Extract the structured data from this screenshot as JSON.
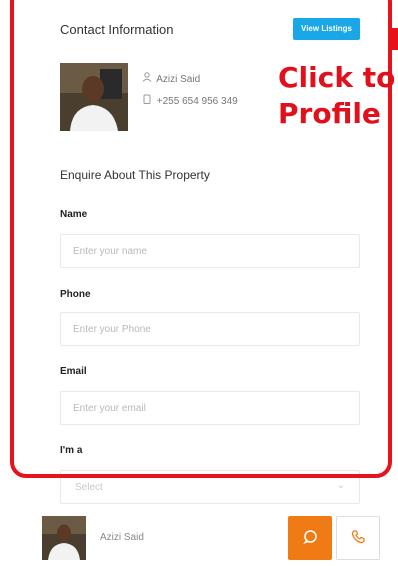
{
  "contact": {
    "title": "Contact Information",
    "view_listings": "View Listings"
  },
  "agent": {
    "name": "Azizi Said",
    "phone": "+255 654 956 349",
    "icons": {
      "name": "user-icon",
      "phone": "phone-icon"
    }
  },
  "annotation": {
    "line1": "Click to",
    "line2": "Profile"
  },
  "form": {
    "heading": "Enquire About This Property",
    "name": {
      "label": "Name",
      "placeholder": "Enter your name"
    },
    "phone": {
      "label": "Phone",
      "placeholder": "Enter your Phone"
    },
    "email": {
      "label": "Email",
      "placeholder": "Enter your email"
    },
    "role": {
      "label": "I'm a",
      "selected": "Select"
    }
  },
  "bottom_bar": {
    "agent_name": "Azizi Said"
  },
  "colors": {
    "accent_blue": "#1aa7e8",
    "accent_orange": "#f07a14",
    "annotation_red": "#e8121a"
  }
}
